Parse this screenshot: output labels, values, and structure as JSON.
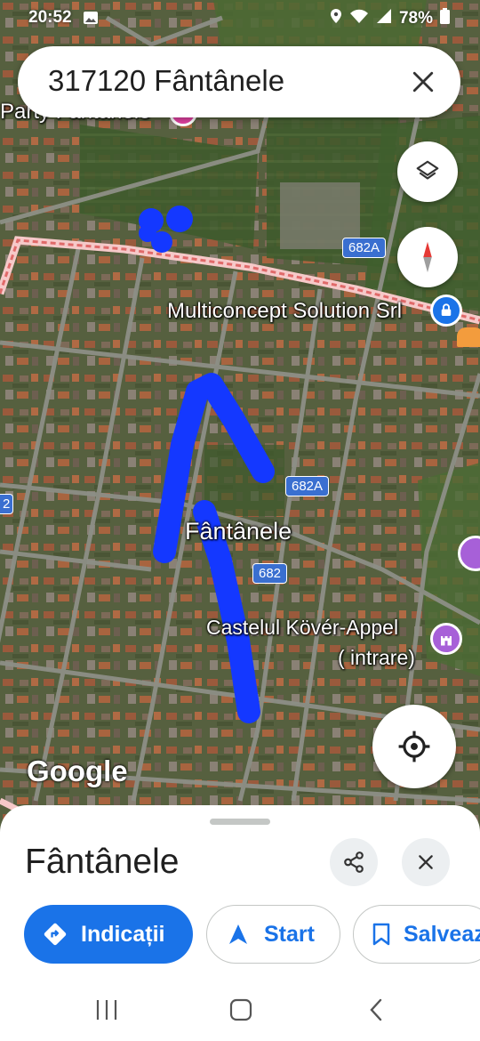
{
  "status_bar": {
    "time": "20:52",
    "battery": "78%",
    "icons": [
      "image-icon",
      "location-icon",
      "wifi-icon",
      "signal-icon",
      "battery-icon"
    ]
  },
  "search": {
    "query": "317120 Fântânele",
    "close_icon": "close-icon"
  },
  "map": {
    "labels": {
      "poi_top_left": "Party Fântânele",
      "business": "Multiconcept Solution Srl",
      "town": "Fântânele",
      "castle_line1": "Castelul Kövér-Appel",
      "castle_line2": "( intrare)"
    },
    "road_shields": {
      "r1": "682A",
      "r2": "682A",
      "r3": "682",
      "r4": "2"
    },
    "attribution": "Google",
    "colors": {
      "annotation_stroke": "#1438ff",
      "boundary": "#f2a7a7",
      "castle_pin": "#a760d8",
      "business_pin": "#1a73e8",
      "party_pin": "#e040a0"
    }
  },
  "sheet": {
    "title": "Fântânele",
    "actions": {
      "directions": "Indicații",
      "start": "Start",
      "save": "Salvează"
    }
  },
  "navbar": {
    "icons": [
      "recent-apps-icon",
      "home-icon",
      "back-icon"
    ]
  }
}
